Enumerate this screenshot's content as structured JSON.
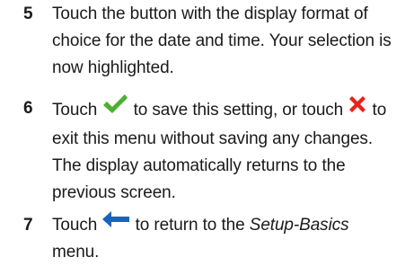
{
  "steps": [
    {
      "number": "5",
      "text": "Touch the button with the display format of choice for the date and time. Your selection is now highlighted."
    },
    {
      "number": "6",
      "text_before_check": "Touch",
      "text_after_check": "to save this setting, or touch",
      "text_after_cross": "to exit this menu without saving any changes. The display automatically returns to the previous screen.",
      "check_icon": "checkmark-icon",
      "cross_icon": "cross-icon"
    },
    {
      "number": "7",
      "text_before_icon": "Touch",
      "text_after_icon": "to return to the",
      "menu_name": "Setup-Basics",
      "text_end": "menu.",
      "back_icon": "back-arrow-icon"
    }
  ],
  "colors": {
    "check": "#4caf32",
    "cross": "#e8221b",
    "back_arrow": "#1565c0",
    "text": "#1a1a1a"
  }
}
